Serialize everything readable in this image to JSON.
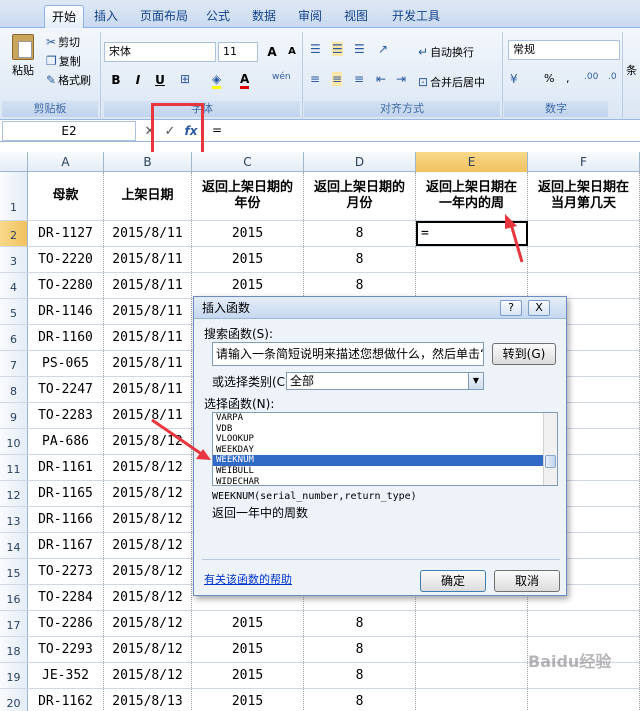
{
  "tabs": [
    {
      "label": "开始",
      "active": true
    },
    {
      "label": "插入"
    },
    {
      "label": "页面布局"
    },
    {
      "label": "公式"
    },
    {
      "label": "数据"
    },
    {
      "label": "审阅"
    },
    {
      "label": "视图"
    },
    {
      "label": "开发工具"
    }
  ],
  "ribbon": {
    "clipboard": {
      "paste": "粘贴",
      "cut": "剪切",
      "copy": "复制",
      "format_painter": "格式刷",
      "label": "剪贴板"
    },
    "font": {
      "name": "宋体",
      "size": "11",
      "bold": "B",
      "italic": "I",
      "underline": "U",
      "grow": "A",
      "shrink": "A",
      "label": "字体"
    },
    "alignment": {
      "wrap": "自动换行",
      "merge": "合并后居中",
      "label": "对齐方式"
    },
    "number": {
      "format": "常规",
      "percent": "%",
      "comma": ",",
      "label": "数字"
    },
    "styles": {
      "label": "条"
    }
  },
  "formula_bar": {
    "name_box": "E2",
    "content": "="
  },
  "columns": [
    "A",
    "B",
    "C",
    "D",
    "E",
    "F"
  ],
  "headers": [
    "母款",
    "上架日期",
    "返回上架日期的\n年份",
    "返回上架日期的\n月份",
    "返回上架日期在\n一年内的周",
    "返回上架日期在\n当月第几天"
  ],
  "rows": [
    {
      "n": "1"
    },
    {
      "n": "2",
      "a": "DR-1127",
      "b": "2015/8/11",
      "c": "2015",
      "d": "8",
      "e": "="
    },
    {
      "n": "3",
      "a": "TO-2220",
      "b": "2015/8/11",
      "c": "2015",
      "d": "8"
    },
    {
      "n": "4",
      "a": "TO-2280",
      "b": "2015/8/11",
      "c": "2015",
      "d": "8"
    },
    {
      "n": "5",
      "a": "DR-1146",
      "b": "2015/8/11",
      "c": "",
      "d": ""
    },
    {
      "n": "6",
      "a": "DR-1160",
      "b": "2015/8/11"
    },
    {
      "n": "7",
      "a": "PS-065",
      "b": "2015/8/11"
    },
    {
      "n": "8",
      "a": "TO-2247",
      "b": "2015/8/11"
    },
    {
      "n": "9",
      "a": "TO-2283",
      "b": "2015/8/11"
    },
    {
      "n": "10",
      "a": "PA-686",
      "b": "2015/8/12"
    },
    {
      "n": "11",
      "a": "DR-1161",
      "b": "2015/8/12"
    },
    {
      "n": "12",
      "a": "DR-1165",
      "b": "2015/8/12"
    },
    {
      "n": "13",
      "a": "DR-1166",
      "b": "2015/8/12"
    },
    {
      "n": "14",
      "a": "DR-1167",
      "b": "2015/8/12"
    },
    {
      "n": "15",
      "a": "TO-2273",
      "b": "2015/8/12"
    },
    {
      "n": "16",
      "a": "TO-2284",
      "b": "2015/8/12"
    },
    {
      "n": "17",
      "a": "TO-2286",
      "b": "2015/8/12",
      "c": "2015",
      "d": "8"
    },
    {
      "n": "18",
      "a": "TO-2293",
      "b": "2015/8/12",
      "c": "2015",
      "d": "8"
    },
    {
      "n": "19",
      "a": "JE-352",
      "b": "2015/8/12",
      "c": "2015",
      "d": "8"
    },
    {
      "n": "20",
      "a": "DR-1162",
      "b": "2015/8/13",
      "c": "2015",
      "d": "8"
    }
  ],
  "dialog": {
    "title": "插入函数",
    "help_btn": "?",
    "close_btn": "X",
    "search_label": "搜索函数(S):",
    "search_value": "请输入一条简短说明来描述您想做什么，然后单击“转到”",
    "go_button": "转到(G)",
    "category_label": "或选择类别(C):",
    "category_value": "全部",
    "list_label": "选择函数(N):",
    "functions": [
      "VARPA",
      "VDB",
      "VLOOKUP",
      "WEEKDAY",
      "WEEKNUM",
      "WEIBULL",
      "WIDECHAR"
    ],
    "selected": "WEEKNUM",
    "signature": "WEEKNUM(serial_number,return_type)",
    "description": "返回一年中的周数",
    "help_link": "有关该函数的帮助",
    "ok": "确定",
    "cancel": "取消"
  },
  "watermark": "Baidu经验"
}
